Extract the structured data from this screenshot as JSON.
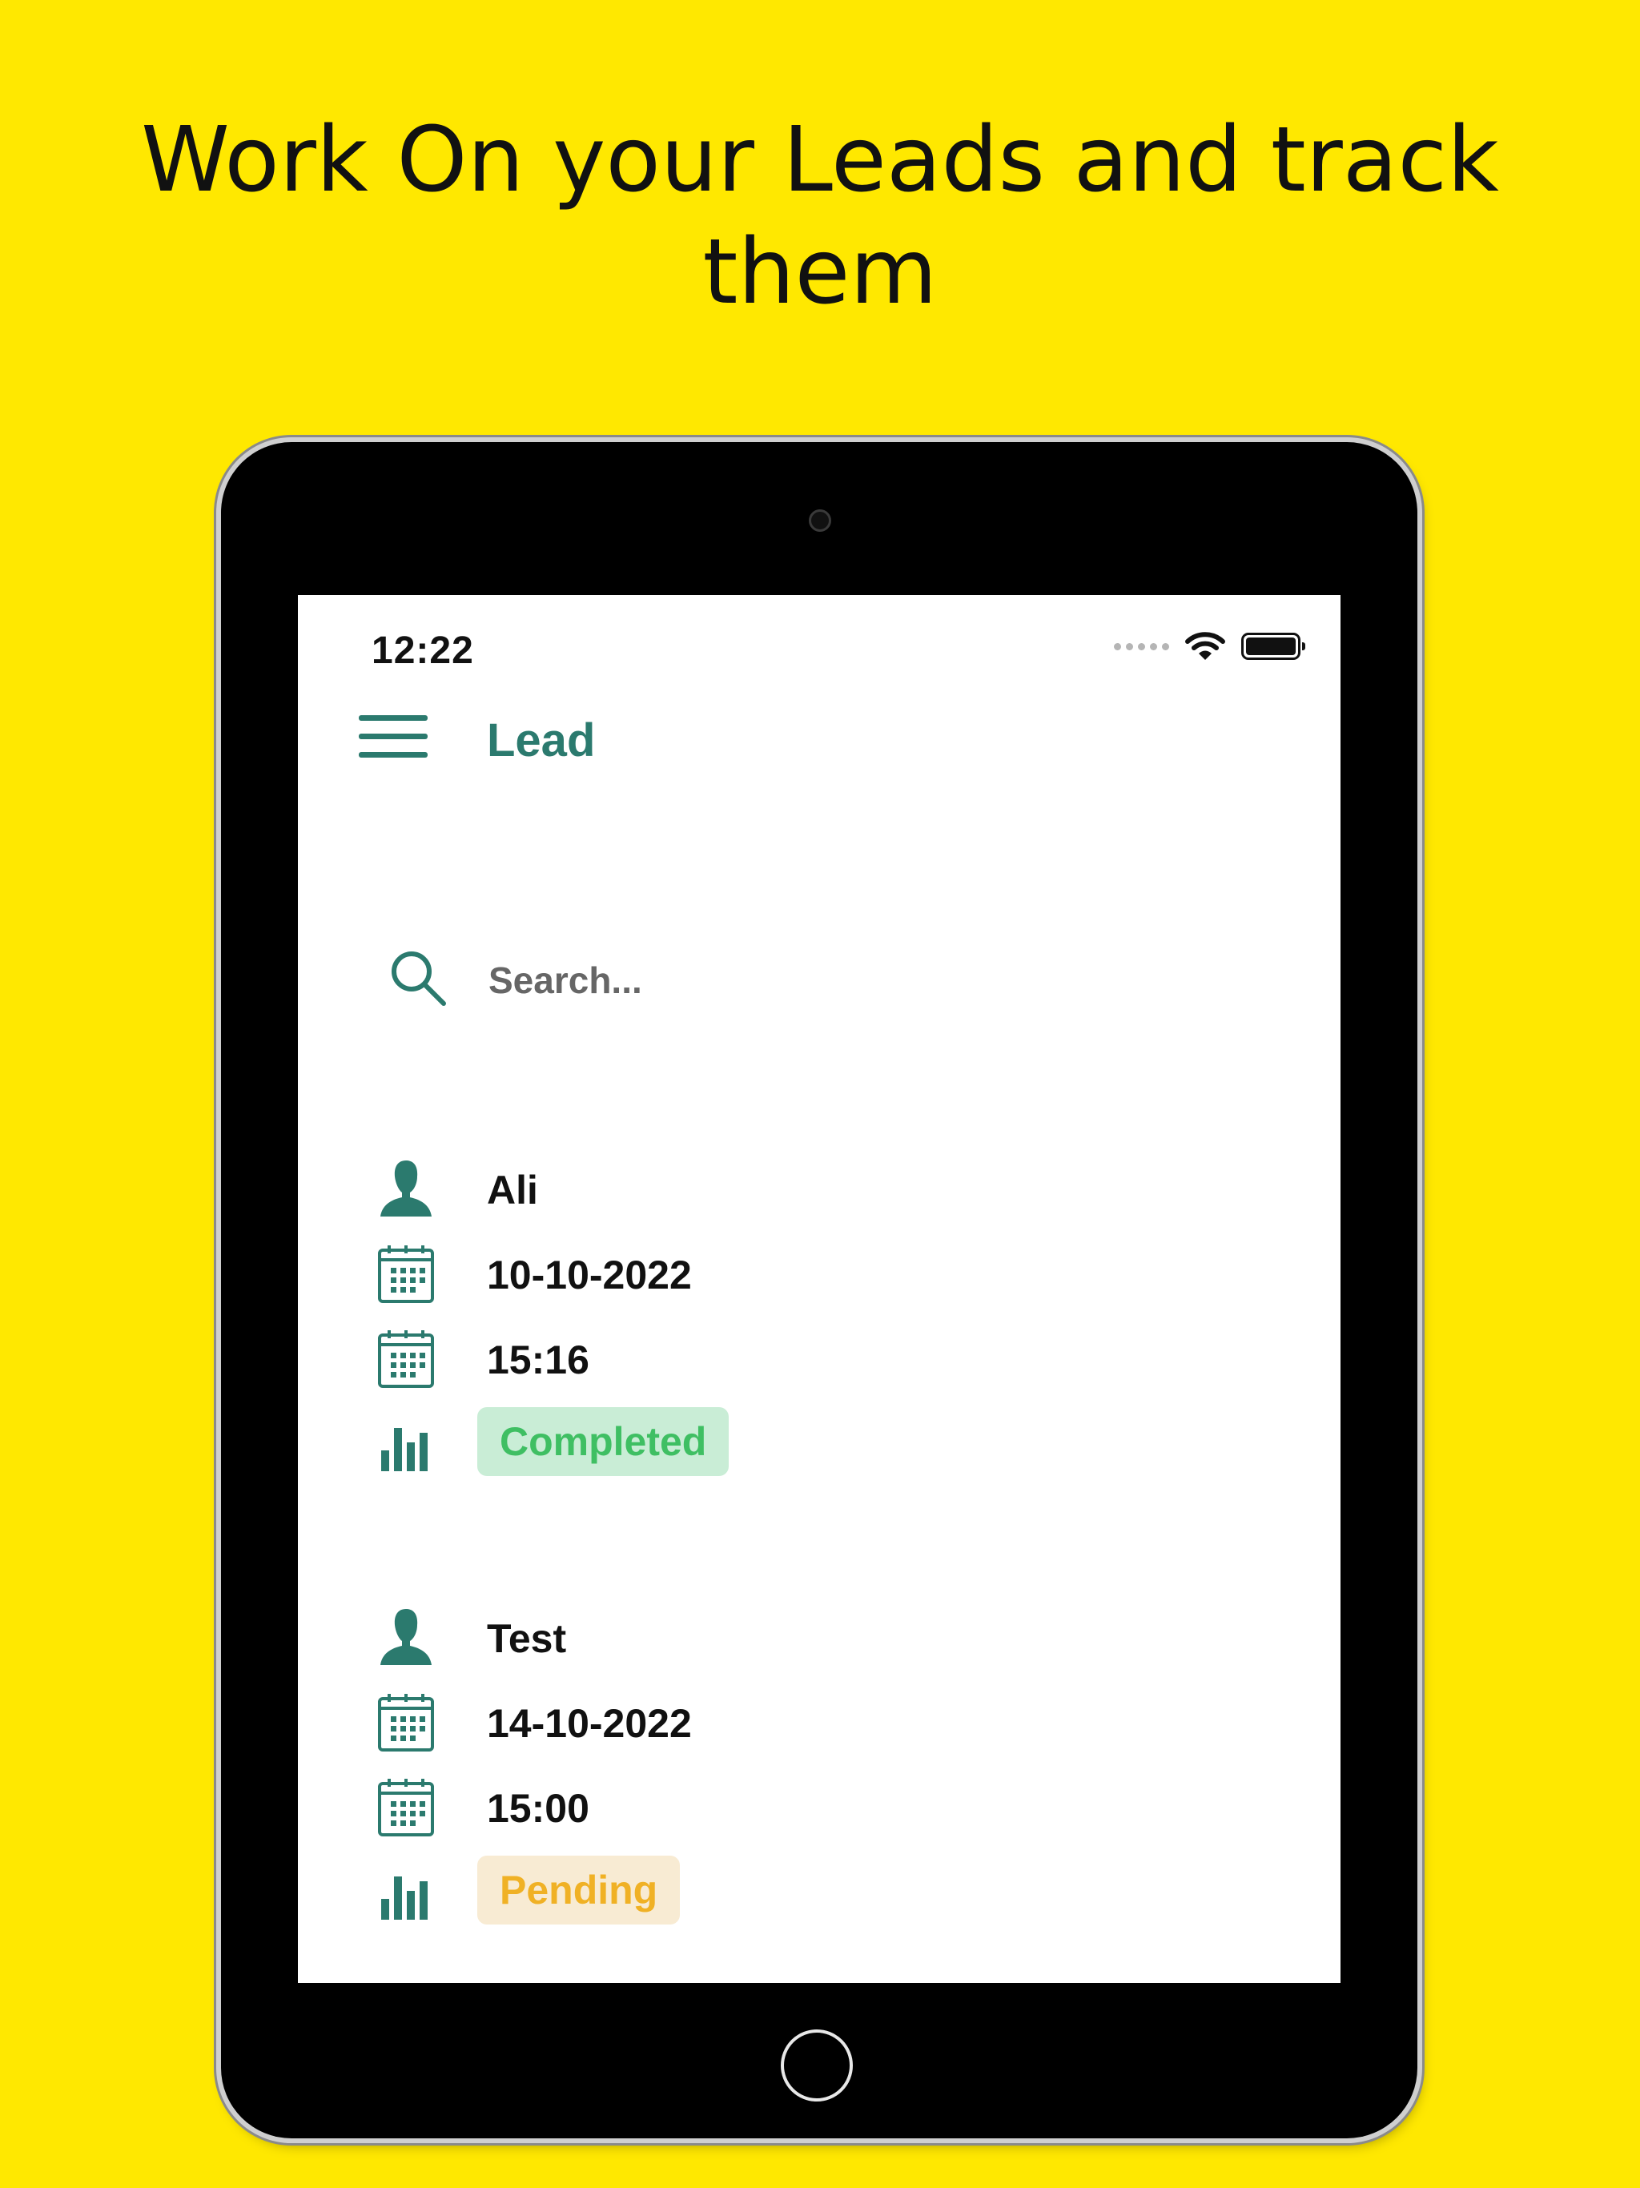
{
  "headline": {
    "line1": "Work On your Leads and track",
    "line2": "them"
  },
  "status_bar": {
    "time": "12:22"
  },
  "nav": {
    "title": "Lead",
    "menu_icon": "hamburger-menu-icon"
  },
  "search": {
    "placeholder": "Search...",
    "value": "",
    "icon": "search-icon"
  },
  "leads": [
    {
      "name": "Ali",
      "date": "10-10-2022",
      "time": "15:16",
      "status": "Completed",
      "status_color": "#3FBF63"
    },
    {
      "name": "Test",
      "date": "14-10-2022",
      "time": "15:00",
      "status": "Pending",
      "status_color": "#F0B125"
    }
  ],
  "colors": {
    "background": "#FFE800",
    "accent": "#2B7A6E",
    "completed_bg": "#C9EDD6",
    "pending_bg": "#F8EBD3"
  }
}
